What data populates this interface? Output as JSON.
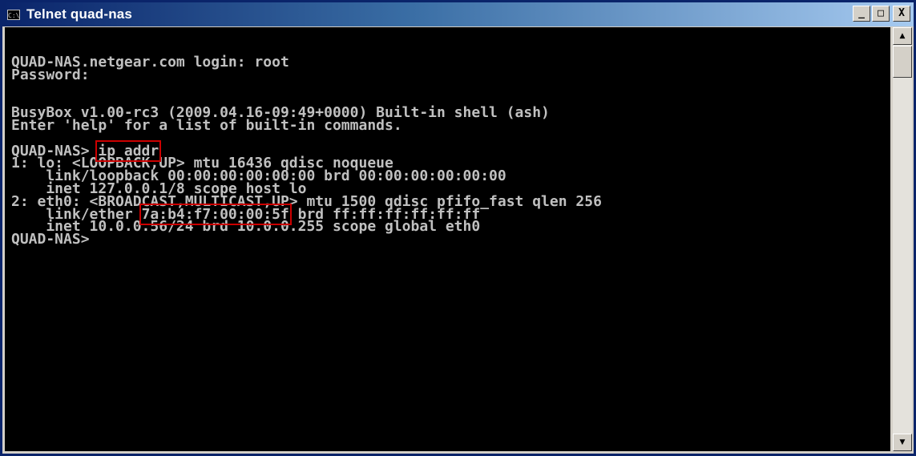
{
  "window": {
    "title": "Telnet quad-nas",
    "icon": "console-icon",
    "icon_text": "C:\\",
    "controls": {
      "minimize": "_",
      "maximize": "□",
      "close": "X"
    }
  },
  "console": {
    "lines": [
      {
        "pre": "QUAD-NAS.netgear.com login: root",
        "hl": "",
        "post": ""
      },
      {
        "pre": "Password:",
        "hl": "",
        "post": ""
      },
      {
        "pre": "",
        "hl": "",
        "post": ""
      },
      {
        "pre": "",
        "hl": "",
        "post": ""
      },
      {
        "pre": "BusyBox v1.00-rc3 (2009.04.16-09:49+0000) Built-in shell (ash)",
        "hl": "",
        "post": ""
      },
      {
        "pre": "Enter 'help' for a list of built-in commands.",
        "hl": "",
        "post": ""
      },
      {
        "pre": "",
        "hl": "",
        "post": ""
      },
      {
        "pre": "QUAD-NAS> ",
        "hl": "ip addr",
        "post": ""
      },
      {
        "pre": "1: lo: <LOOPBACK,UP> mtu 16436 qdisc noqueue",
        "hl": "",
        "post": ""
      },
      {
        "pre": "    link/loopback 00:00:00:00:00:00 brd 00:00:00:00:00:00",
        "hl": "",
        "post": ""
      },
      {
        "pre": "    inet 127.0.0.1/8 scope host lo",
        "hl": "",
        "post": ""
      },
      {
        "pre": "2: eth0: <BROADCAST,MULTICAST,UP> mtu 1500 qdisc pfifo_fast qlen 256",
        "hl": "",
        "post": ""
      },
      {
        "pre": "    link/ether ",
        "hl": "7a:b4:f7:00:00:5f",
        "post": " brd ff:ff:ff:ff:ff:ff"
      },
      {
        "pre": "    inet 10.0.0.56/24 brd 10.0.0.255 scope global eth0",
        "hl": "",
        "post": ""
      },
      {
        "pre": "QUAD-NAS>",
        "hl": "",
        "post": ""
      }
    ],
    "text_color": "#c0c0c0",
    "background": "#000000",
    "highlight_color": "#cc0000"
  },
  "scrollbar": {
    "up_arrow": "▲",
    "down_arrow": "▼"
  }
}
